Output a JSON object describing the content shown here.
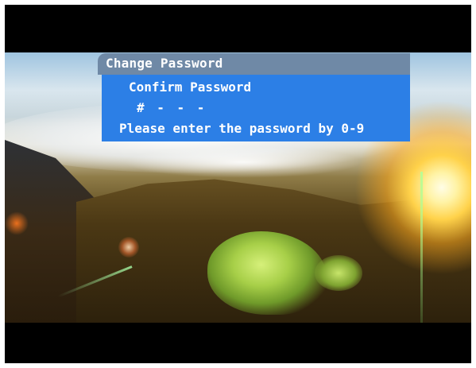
{
  "dialog": {
    "title": "Change Password",
    "field_label": "Confirm Password",
    "entry_value": "# - - -",
    "hint": "Please enter the password by 0-9"
  },
  "colors": {
    "title_bar": "#6f89a6",
    "panel": "#2c7fe6",
    "text": "#ffffff",
    "letterbox": "#000000"
  }
}
